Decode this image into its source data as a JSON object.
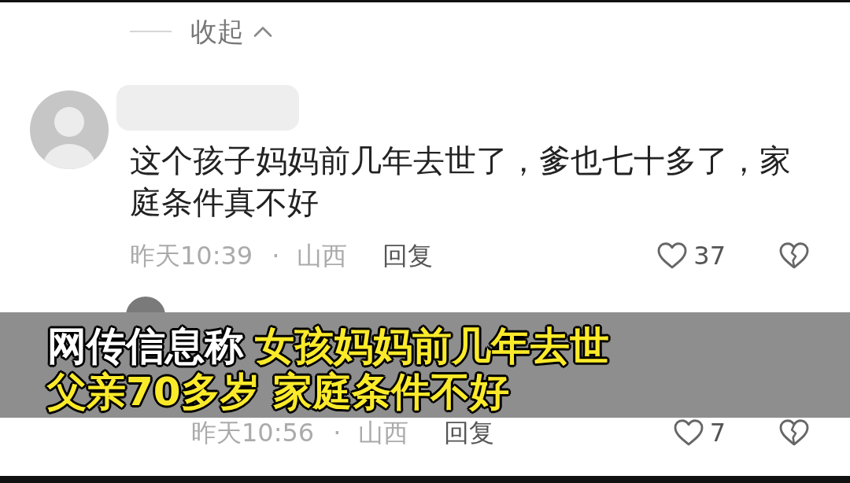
{
  "collapse_toggle": {
    "label": "收起",
    "expanded": true
  },
  "comments": [
    {
      "text": "这个孩子妈妈前几年去世了，爹也七十多了，家庭条件真不好",
      "time": "昨天10:39",
      "separator": "·",
      "location": "山西",
      "reply": "回复",
      "likes": "37",
      "children": [
        {
          "time": "昨天10:56",
          "separator": "·",
          "location": "山西",
          "reply": "回复",
          "likes": "7"
        }
      ]
    }
  ],
  "caption": {
    "lines": [
      {
        "segments": [
          {
            "text": "网传信息称",
            "color": "#ffffff"
          },
          {
            "text": "女孩妈妈前几年去世",
            "color": "#fbea2a"
          }
        ]
      },
      {
        "segments": [
          {
            "text": "父亲70多岁 家庭条件不好",
            "color": "#fbea2a"
          }
        ]
      }
    ]
  }
}
